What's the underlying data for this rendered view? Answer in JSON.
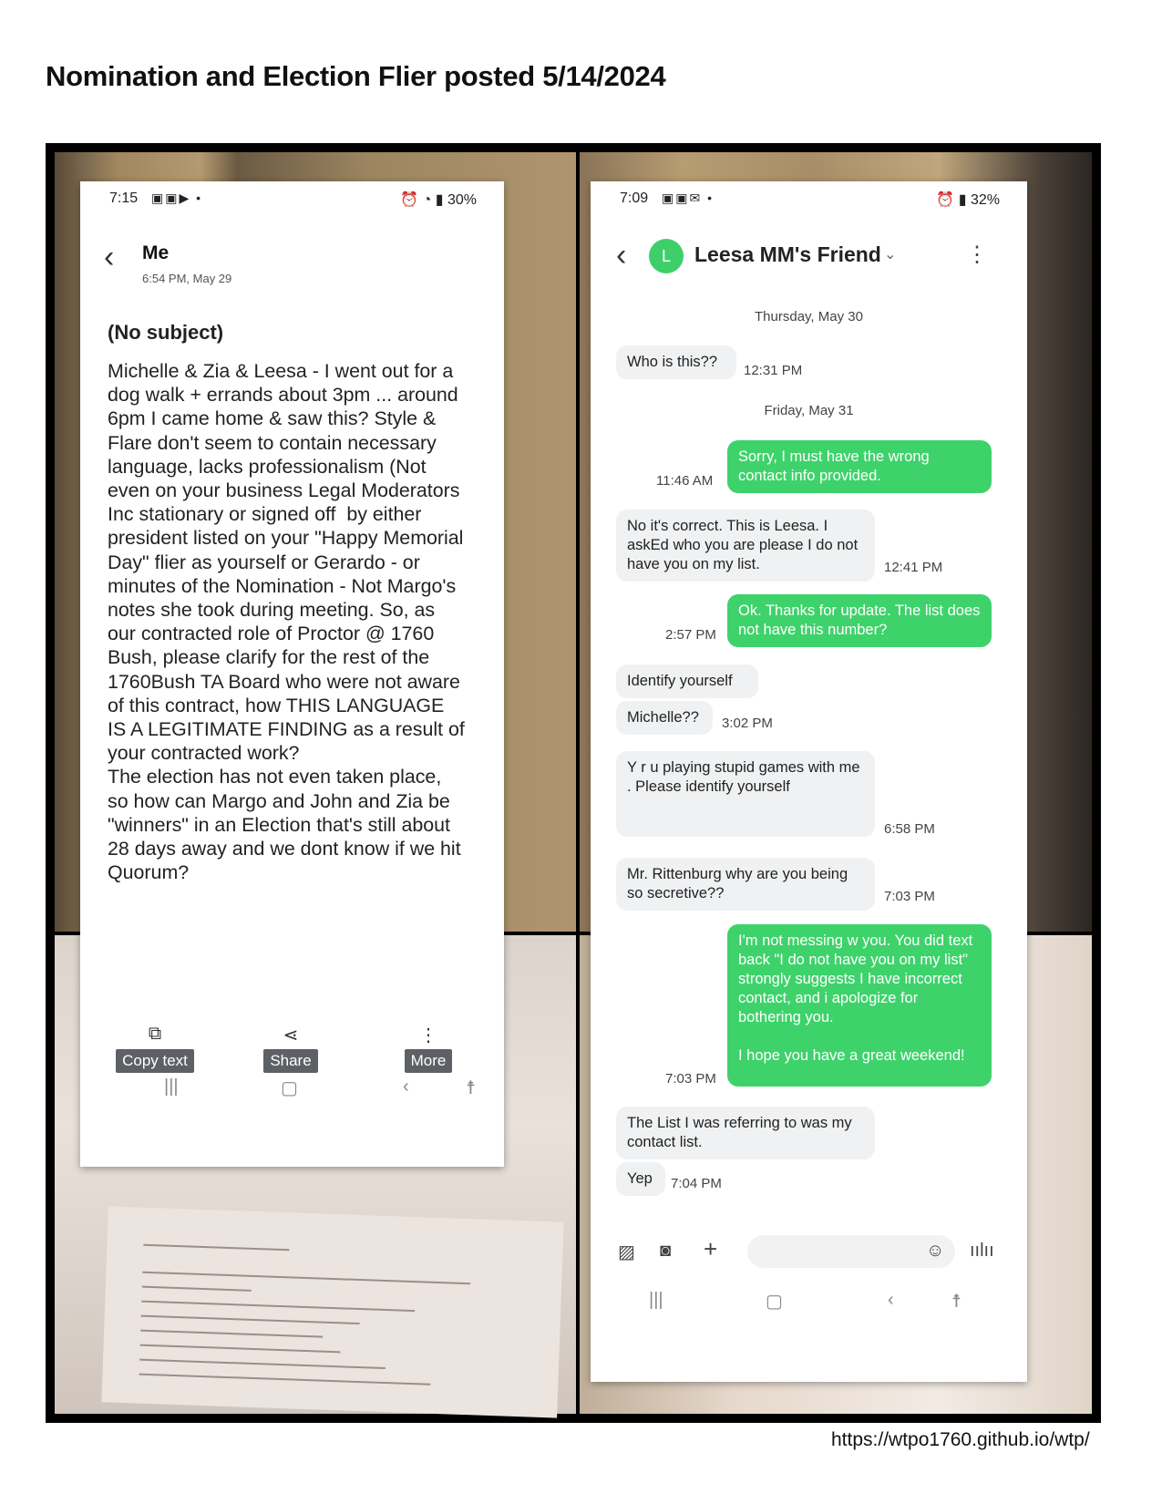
{
  "document": {
    "title": "Nomination and Election Flier posted 5/14/2024",
    "footer_url": "https://wtpo1760.github.io/wtp/"
  },
  "email_screen": {
    "status": {
      "time": "7:15",
      "battery": "30%"
    },
    "sender": "Me",
    "date": "6:54 PM, May 29",
    "subject": "(No subject)",
    "body": "Michelle & Zia & Leesa - I went out for a\ndog walk + errands about 3pm ... around\n6pm I came home & saw this? Style &\nFlare don't seem to contain necessary\nlanguage, lacks professionalism (Not\neven on your business Legal Moderators\nInc stationary or signed off  by either\npresident listed on your \"Happy Memorial\nDay\" flier as yourself or Gerardo - or\nminutes of the Nomination - Not Margo's\nnotes she took during meeting. So, as\nour contracted role of Proctor @ 1760\nBush, please clarify for the rest of the\n1760Bush TA Board who were not aware\nof this contract, how THIS LANGUAGE\nIS A LEGITIMATE FINDING as a result of\nyour contracted work?\nThe election has not even taken place,\nso how can Margo and John and Zia be\n\"winners\" in an Election that's still about\n28 days away and we dont know if we hit\nQuorum?",
    "actions": {
      "copy": "Copy text",
      "share": "Share",
      "more": "More"
    },
    "icons": {
      "back": "chevron-left-icon",
      "copy": "copy-icon",
      "share": "share-icon",
      "more": "more-vert-icon"
    }
  },
  "sms_screen": {
    "status": {
      "time": "7:09",
      "battery": "32%"
    },
    "contact": {
      "initial": "L",
      "name": "Leesa MM's Friend",
      "avatar_color": "#3ecf6a"
    },
    "day_separators": [
      "Thursday, May 30",
      "Friday, May 31"
    ],
    "messages": [
      {
        "dir": "in",
        "text": "Who is this??",
        "time": "12:31 PM"
      },
      {
        "dir": "out",
        "text": "Sorry, I must have the wrong contact info provided.",
        "time": "11:46 AM"
      },
      {
        "dir": "in",
        "text": "No it's correct. This is Leesa. I askEd who you are please I do not have you on my list.",
        "time": "12:41 PM"
      },
      {
        "dir": "out",
        "text": "Ok. Thanks for update. The list does not have this number?",
        "time": "2:57 PM"
      },
      {
        "dir": "in",
        "text": "Identify yourself",
        "time": ""
      },
      {
        "dir": "in",
        "text": "Michelle??",
        "time": "3:02 PM"
      },
      {
        "dir": "in",
        "text": "Y r u playing stupid games with me . Please identify yourself",
        "time": "6:58 PM"
      },
      {
        "dir": "in",
        "text": "Mr. Rittenburg why are you being so secretive??",
        "time": "7:03 PM"
      },
      {
        "dir": "out",
        "text": "I'm not messing w you. You did text back \"I do not have you on my list\" strongly suggests I have incorrect contact, and i apologize for bothering you.\n\nI hope you have a great weekend!",
        "time": "7:03 PM"
      },
      {
        "dir": "in",
        "text": "The List I was referring to was my contact list.",
        "time": ""
      },
      {
        "dir": "in",
        "text": "Yep",
        "time": "7:04 PM"
      }
    ],
    "colors": {
      "outgoing": "#3ed26b",
      "incoming": "#f0f1f2"
    }
  }
}
